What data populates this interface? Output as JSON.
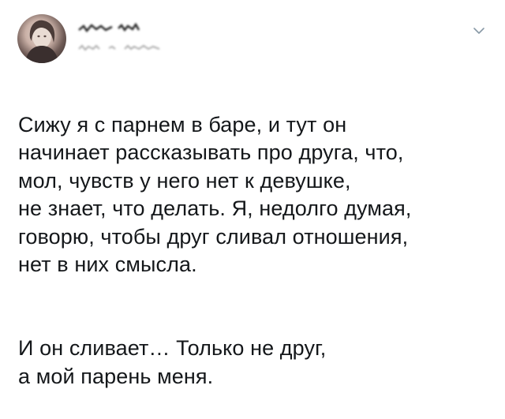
{
  "tweet": {
    "author": {
      "display_name": "",
      "handle": "",
      "avatar_icon": "user-avatar"
    },
    "menu_icon": "chevron-down-icon",
    "text": {
      "paragraph1": "Сижу я с парнем в баре, и тут он\nначинает рассказывать про друга, что,\nмол, чувств у него нет к девушке,\nне знает, что делать. Я, недолго думая,\nговорю, чтобы друг сливал отношения,\nнет в них смысла.",
      "paragraph2": "И он сливает… Только не друг,\nа мой парень меня."
    }
  },
  "colors": {
    "text": "#14171a",
    "icon": "#8899a6",
    "background": "#ffffff"
  }
}
